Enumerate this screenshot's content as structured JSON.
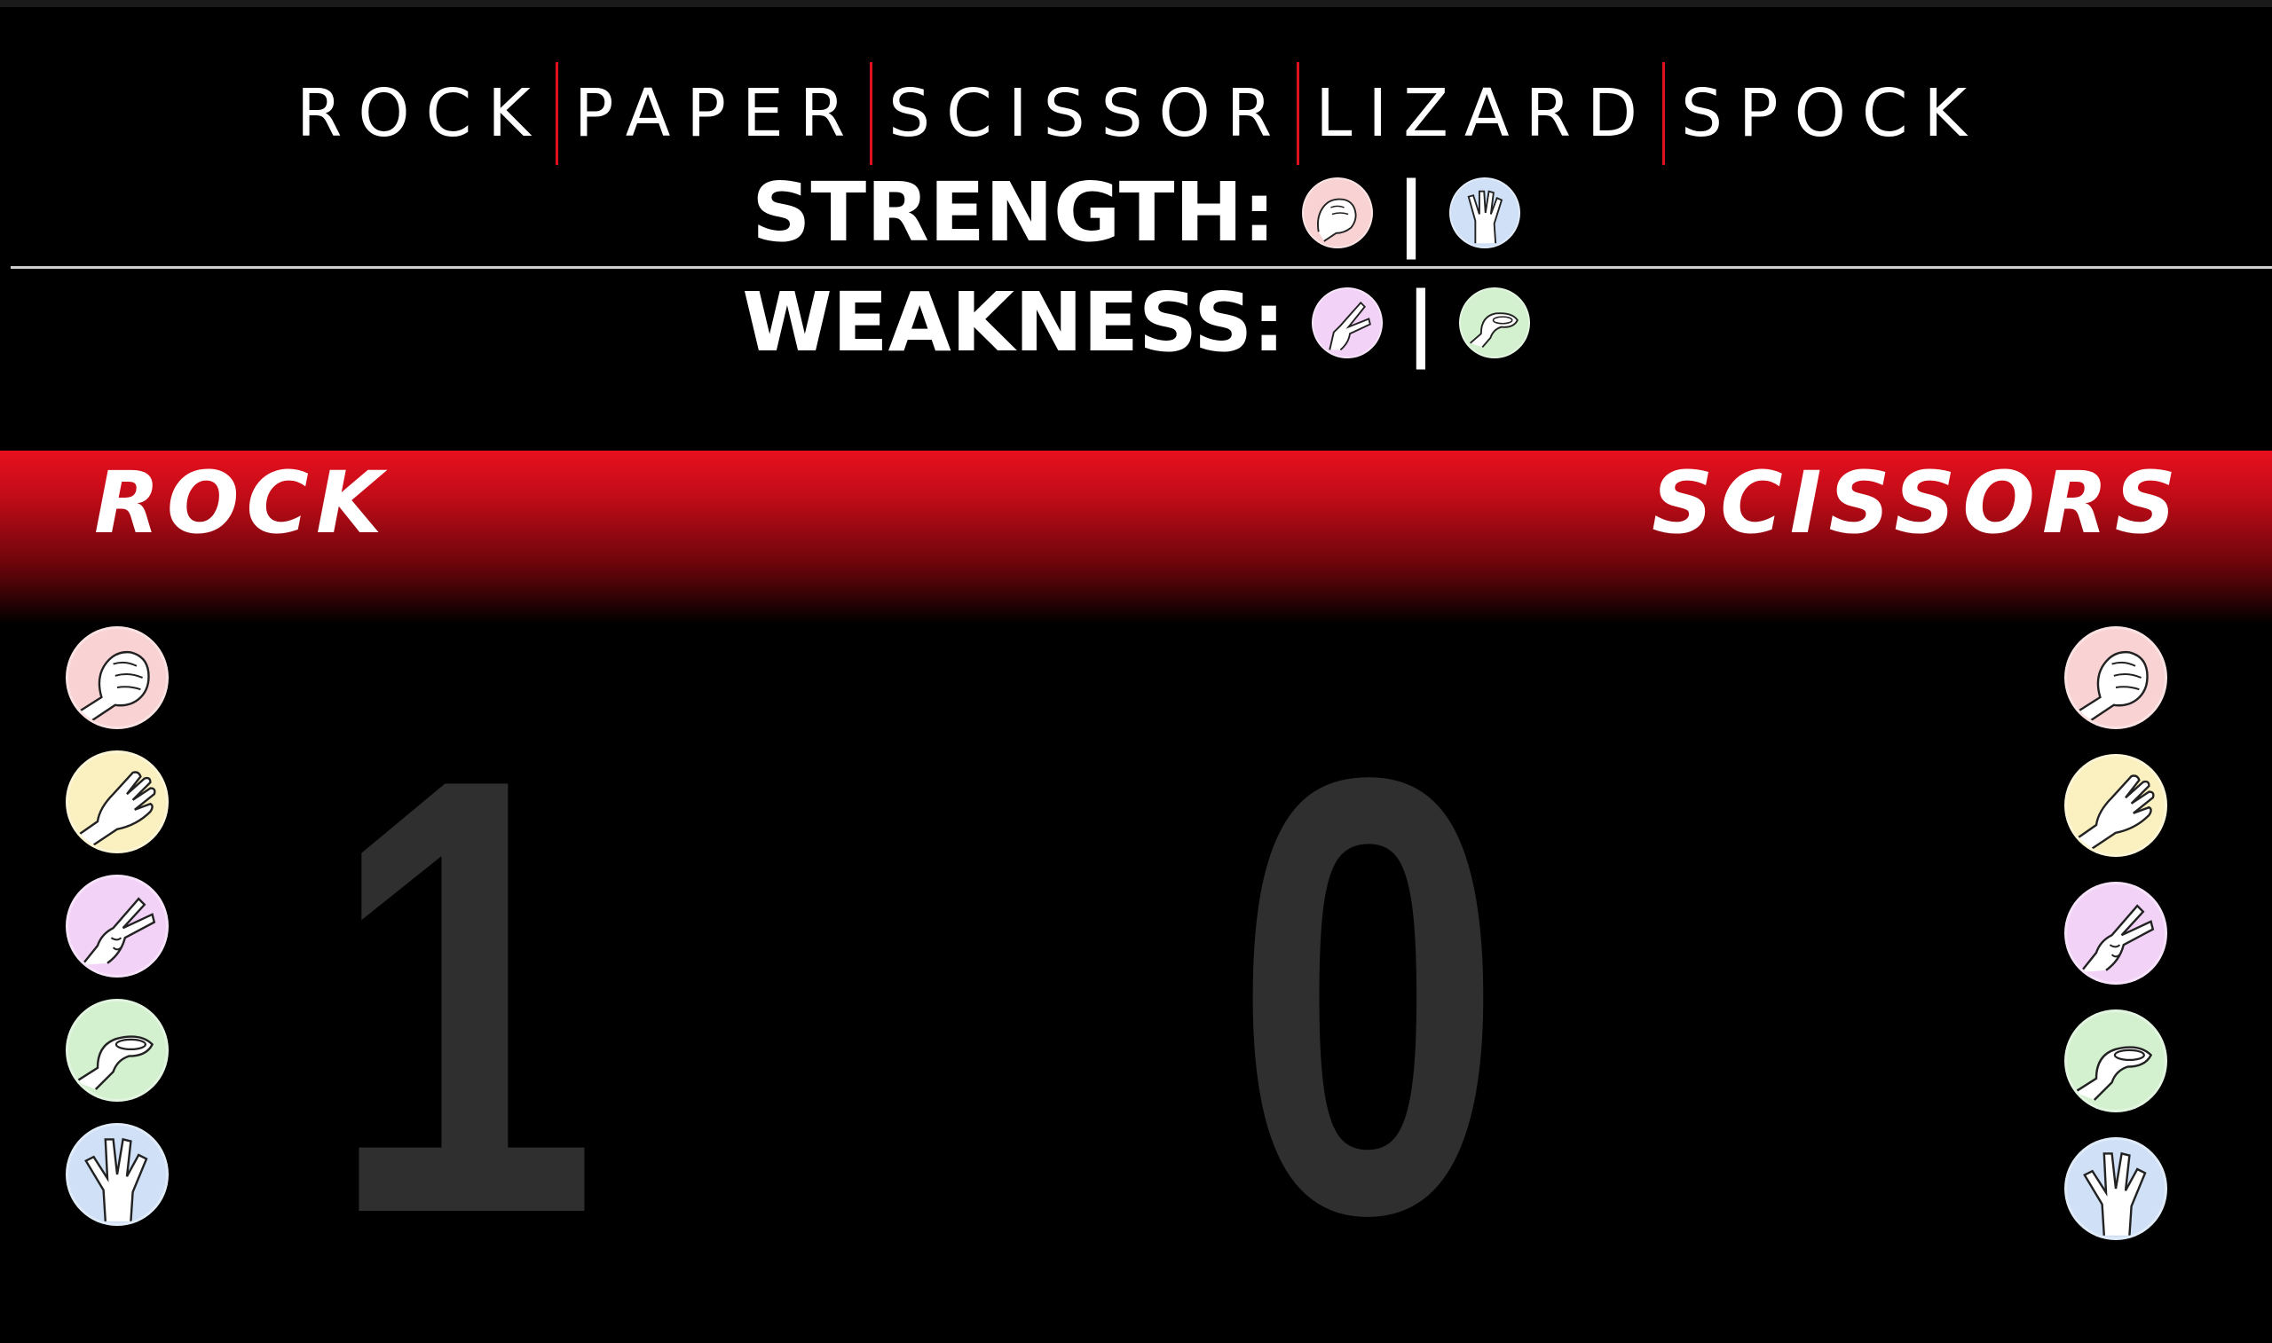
{
  "title": {
    "words": [
      "ROCK",
      "PAPER",
      "SCISSOR",
      "LIZARD",
      "SPOCK"
    ],
    "separator_color": "#e0101c"
  },
  "strength": {
    "label": "STRENGTH:",
    "separator": "|",
    "icons": [
      "rock-icon",
      "spock-icon"
    ]
  },
  "weakness": {
    "label": "WEAKNESS:",
    "separator": "|",
    "icons": [
      "scissors-icon",
      "lizard-icon"
    ]
  },
  "players": {
    "left": {
      "name": "ROCK",
      "score": "1"
    },
    "right": {
      "name": "SCISSORS",
      "score": "0"
    }
  },
  "moves": [
    {
      "name": "rock-icon",
      "color": "#f9d3d3"
    },
    {
      "name": "paper-icon",
      "color": "#fbf0c0"
    },
    {
      "name": "scissors-icon",
      "color": "#f2d3f7"
    },
    {
      "name": "lizard-icon",
      "color": "#d3f0cf"
    },
    {
      "name": "spock-icon",
      "color": "#cfe0f7"
    }
  ],
  "colors": {
    "banner_red": "#e8101e",
    "score_gray": "#2f2f2f"
  }
}
